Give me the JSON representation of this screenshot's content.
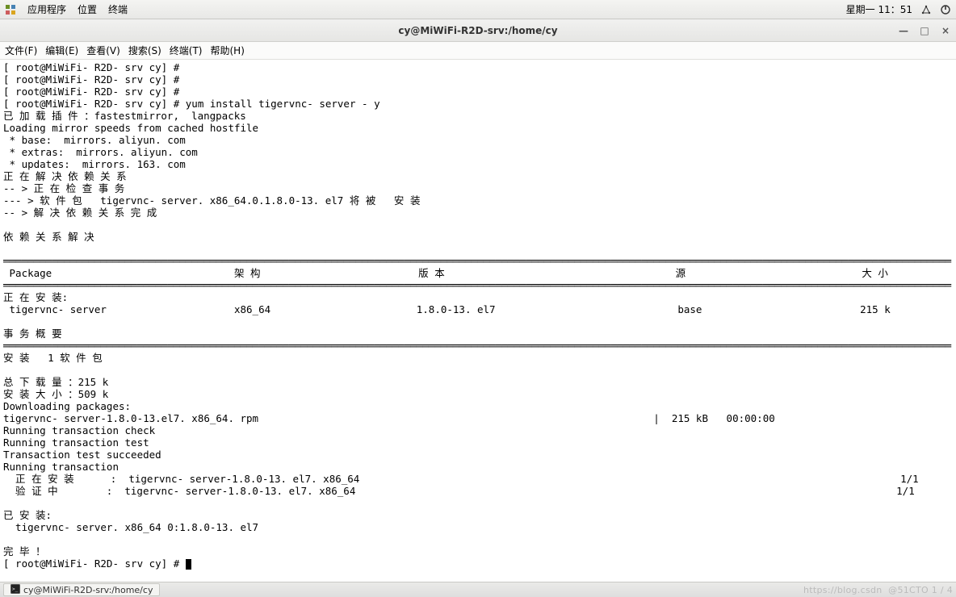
{
  "top_panel": {
    "menus": [
      "应用程序",
      "位置",
      "终端"
    ],
    "clock": "星期一 11：51"
  },
  "window": {
    "title": "cy@MiWiFi-R2D-srv:/home/cy"
  },
  "menubar": {
    "items": [
      "文件(F)",
      "编辑(E)",
      "查看(V)",
      "搜索(S)",
      "终端(T)",
      "帮助(H)"
    ]
  },
  "terminal": {
    "lines": [
      "[ root@MiWiFi- R2D- srv cy] #",
      "[ root@MiWiFi- R2D- srv cy] #",
      "[ root@MiWiFi- R2D- srv cy] #",
      "[ root@MiWiFi- R2D- srv cy] # yum install tigervnc- server - y",
      "已 加 载 插 件 ：fastestmirror,  langpacks",
      "Loading mirror speeds from cached hostfile",
      " * base:  mirrors. aliyun. com",
      " * extras:  mirrors. aliyun. com",
      " * updates:  mirrors. 163. com",
      "正 在 解 决 依 赖 关 系",
      "-- > 正 在 检 查 事 务",
      "--- > 软 件 包   tigervnc- server. x86_64.0.1.8.0-13. el7 将 被   安 装",
      "-- > 解 决 依 赖 关 系 完 成",
      "",
      "依 赖 关 系 解 决",
      "",
      "════════════════════════════════════════════════════════════════════════════════════════════════════════════════════════════════════════════════════════════",
      " Package                              架 构                          版 本                                      源                             大 小",
      "════════════════════════════════════════════════════════════════════════════════════════════════════════════════════════════════════════════════════════════",
      "正 在 安 装:",
      " tigervnc- server                     x86_64                        1.8.0-13. el7                              base                          215 k",
      "",
      "事 务 概 要",
      "════════════════════════════════════════════════════════════════════════════════════════════════════════════════════════════════════════════════════════════",
      "安 装   1 软 件 包",
      "",
      "总 下 载 量 ：215 k",
      "安 装 大 小 ：509 k",
      "Downloading packages:",
      "tigervnc- server-1.8.0-13.el7. x86_64. rpm                                                                 |  215 kB   00:00:00",
      "Running transaction check",
      "Running transaction test",
      "Transaction test succeeded",
      "Running transaction",
      "  正 在 安 装      :  tigervnc- server-1.8.0-13. el7. x86_64                                                                                         1/1",
      "  验 证 中        :  tigervnc- server-1.8.0-13. el7. x86_64                                                                                         1/1",
      "",
      "已 安 装:",
      "  tigervnc- server. x86_64 0:1.8.0-13. el7",
      "",
      "完 毕 ！",
      "[ root@MiWiFi- R2D- srv cy] # "
    ]
  },
  "taskbar": {
    "task": "cy@MiWiFi-R2D-srv:/home/cy",
    "watermark_left": "https://blog.csdn",
    "watermark_right": "@51CTO 1 / 4"
  }
}
